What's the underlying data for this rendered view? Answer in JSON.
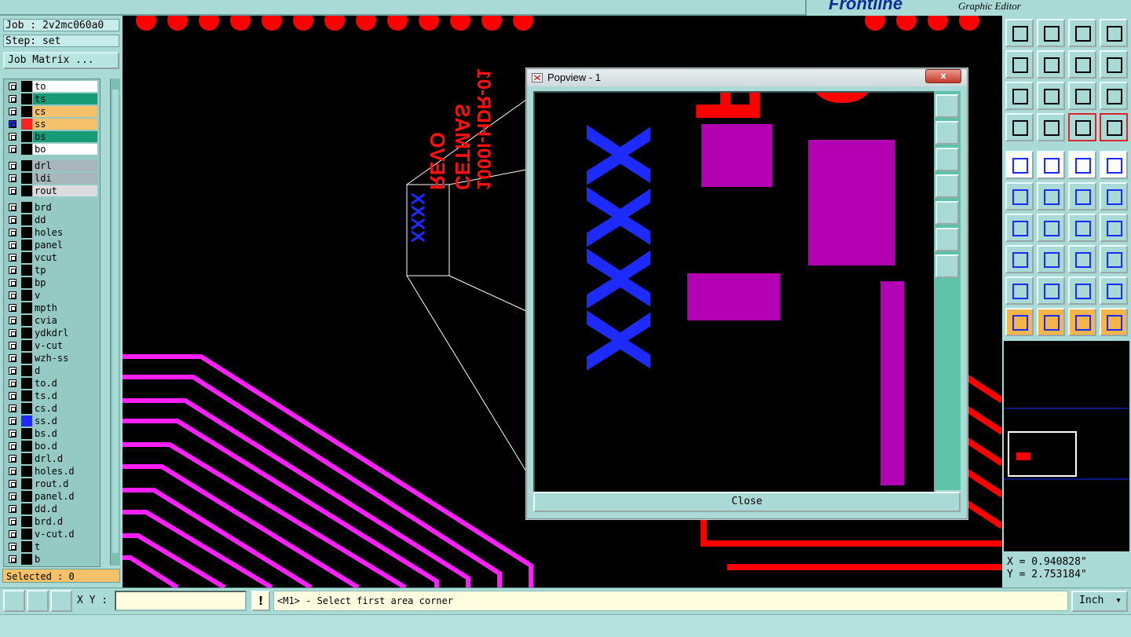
{
  "app": {
    "logo": "Frontline",
    "subtitle": "Graphic Editor"
  },
  "job": {
    "line": "Job : 2v2mc060a0",
    "step": "Step: set",
    "matrix_button": "Job Matrix ..."
  },
  "layers": [
    {
      "name": "to",
      "bg": "#ffffff",
      "swatch": "#000000"
    },
    {
      "name": "ts",
      "bg": "#169b76",
      "swatch": "#000000"
    },
    {
      "name": "cs",
      "bg": "#f5c26b",
      "swatch": "#000000"
    },
    {
      "name": "ss",
      "bg": "#f5c26b",
      "swatch": "#ff2020",
      "active": true
    },
    {
      "name": "bs",
      "bg": "#169b76",
      "swatch": "#000000"
    },
    {
      "name": "bo",
      "bg": "#ffffff",
      "swatch": "#000000"
    },
    {
      "name": "drl",
      "bg": "#a8b6bc",
      "swatch": "#000000"
    },
    {
      "name": "ldi",
      "bg": "#a8b6bc",
      "swatch": "#000000"
    },
    {
      "name": "rout",
      "bg": "#dcdcdc",
      "swatch": "#000000"
    },
    {
      "name": "brd",
      "bg": "#94c9c4",
      "swatch": "#000000"
    },
    {
      "name": "dd",
      "bg": "#94c9c4",
      "swatch": "#000000"
    },
    {
      "name": "holes",
      "bg": "#94c9c4",
      "swatch": "#000000"
    },
    {
      "name": "panel",
      "bg": "#94c9c4",
      "swatch": "#000000"
    },
    {
      "name": "vcut",
      "bg": "#94c9c4",
      "swatch": "#000000"
    },
    {
      "name": "tp",
      "bg": "#94c9c4",
      "swatch": "#000000"
    },
    {
      "name": "bp",
      "bg": "#94c9c4",
      "swatch": "#000000"
    },
    {
      "name": "v",
      "bg": "#94c9c4",
      "swatch": "#000000"
    },
    {
      "name": "mpth",
      "bg": "#94c9c4",
      "swatch": "#000000"
    },
    {
      "name": "cvia",
      "bg": "#94c9c4",
      "swatch": "#000000"
    },
    {
      "name": "ydkdrl",
      "bg": "#94c9c4",
      "swatch": "#000000"
    },
    {
      "name": "v-cut",
      "bg": "#94c9c4",
      "swatch": "#000000"
    },
    {
      "name": "wzh-ss",
      "bg": "#94c9c4",
      "swatch": "#000000"
    },
    {
      "name": "d",
      "bg": "#94c9c4",
      "swatch": "#000000"
    },
    {
      "name": "to.d",
      "bg": "#94c9c4",
      "swatch": "#000000"
    },
    {
      "name": "ts.d",
      "bg": "#94c9c4",
      "swatch": "#000000"
    },
    {
      "name": "cs.d",
      "bg": "#94c9c4",
      "swatch": "#000000"
    },
    {
      "name": "ss.d",
      "bg": "#94c9c4",
      "swatch": "#1e2bff"
    },
    {
      "name": "bs.d",
      "bg": "#94c9c4",
      "swatch": "#000000"
    },
    {
      "name": "bo.d",
      "bg": "#94c9c4",
      "swatch": "#000000"
    },
    {
      "name": "drl.d",
      "bg": "#94c9c4",
      "swatch": "#000000"
    },
    {
      "name": "holes.d",
      "bg": "#94c9c4",
      "swatch": "#000000"
    },
    {
      "name": "rout.d",
      "bg": "#94c9c4",
      "swatch": "#000000"
    },
    {
      "name": "panel.d",
      "bg": "#94c9c4",
      "swatch": "#000000"
    },
    {
      "name": "dd.d",
      "bg": "#94c9c4",
      "swatch": "#000000"
    },
    {
      "name": "brd.d",
      "bg": "#94c9c4",
      "swatch": "#000000"
    },
    {
      "name": "v-cut.d",
      "bg": "#94c9c4",
      "swatch": "#000000"
    },
    {
      "name": "t",
      "bg": "#94c9c4",
      "swatch": "#000000"
    },
    {
      "name": "b",
      "bg": "#94c9c4",
      "swatch": "#000000"
    }
  ],
  "selected": "Selected : 0",
  "popview": {
    "title": "Popview - 1",
    "close_x": "x",
    "close_button": "Close",
    "text_blue": "XXXX",
    "text_red_1": "REVO",
    "text_red_2": "CETMAS"
  },
  "canvas_labels": {
    "blue": "XXXX",
    "red_1": "REVO",
    "red_2": "CETMAS",
    "red_3": "1000I-HDR-01"
  },
  "coords": {
    "x": "X = 0.940828\"",
    "y": "Y = 2.753184\""
  },
  "bottom": {
    "xy_label": "X Y :",
    "xy_value": "",
    "warn": "!",
    "status": "<M1> - Select first area corner",
    "units": "Inch"
  },
  "tools": [
    "zoom-home-icon",
    "zoom-in-icon",
    "zoom-home-page-icon",
    "zoom-fit-icon",
    "pan-left-icon",
    "pan-right-icon",
    "undo-icon",
    "redo-icon",
    "fit-screen-icon",
    "center-icon",
    "ratio-icon",
    "help-icon",
    "settings-icon",
    "measure-icon",
    "traffic-light-icon",
    "traffic-light-red-icon",
    "pad-icon",
    "line-icon",
    "ruler-icon",
    "circle-pad-icon",
    "connect-icon",
    "cross-icon",
    "snap-icon",
    "snap-point-icon",
    "angle-icon",
    "diagonal-icon",
    "rotate-icon",
    "mirror-icon",
    "move-icon",
    "split-icon",
    "resize-icon",
    "group-icon",
    "triangle-icon",
    "triangle-up-icon",
    "arc-icon",
    "arc-cross-icon",
    "select-icon",
    "select-box-icon",
    "select-circle-icon",
    "select-network-icon"
  ],
  "colors": {
    "panel": "#a9dad6",
    "accent_red": "#ff0000",
    "accent_blue": "#1e2bff",
    "accent_magenta": "#ff00ff"
  }
}
